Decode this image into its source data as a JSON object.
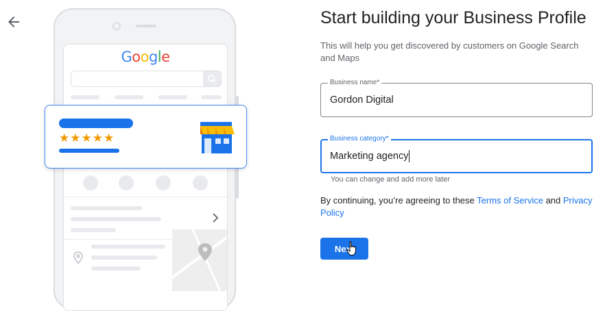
{
  "nav": {
    "back_icon": "arrow-back-icon"
  },
  "illustration": {
    "logo_letters": [
      "G",
      "o",
      "o",
      "g",
      "l",
      "e"
    ],
    "stars": "★★★★★",
    "brand_colors": {
      "blue": "#4285f4",
      "red": "#ea4335",
      "yellow": "#fbbc05",
      "green": "#34a853"
    },
    "store_icon": "storefront-icon",
    "search_icon": "search-icon",
    "action_icons": [
      "phone-icon",
      "directions-icon",
      "bookmark-icon",
      "website-icon"
    ],
    "location_icon": "location-pin-icon"
  },
  "form": {
    "title": "Start building your Business Profile",
    "subtitle": "This will help you get discovered by customers on Google Search and Maps",
    "business_name": {
      "label": "Business name*",
      "value": "Gordon Digital"
    },
    "business_category": {
      "label": "Business category*",
      "value": "Marketing agency",
      "helper": "You can change and add more later"
    },
    "terms": {
      "prefix": "By continuing, you’re agreeing to these ",
      "tos_link": "Terms of Service",
      "middle": " and ",
      "privacy_link": "Privacy Policy"
    },
    "next_label": "Next"
  },
  "colors": {
    "accent": "#1a73e8",
    "star": "#f29900",
    "text": "#202124",
    "muted": "#5f6368"
  }
}
